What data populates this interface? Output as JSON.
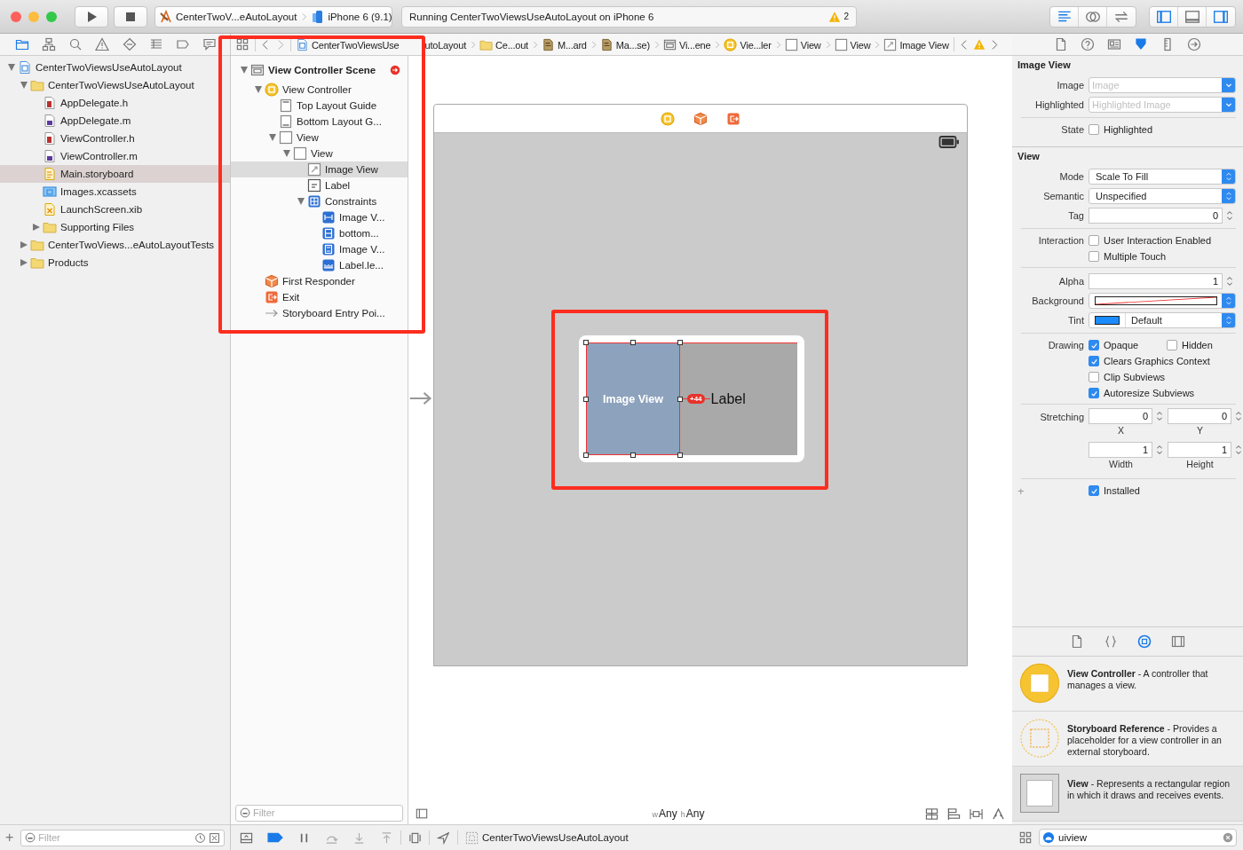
{
  "toolbar": {
    "scheme": "CenterTwoV...eAutoLayout",
    "device": "iPhone 6 (9.1)",
    "status": "Running CenterTwoViewsUseAutoLayout on iPhone 6",
    "warning_count": "2",
    "editor_modes": [
      {
        "kind": "standard",
        "selected": true
      },
      {
        "kind": "assistant",
        "selected": false
      },
      {
        "kind": "version",
        "selected": false
      }
    ],
    "panels": [
      {
        "kind": "navigator-panel",
        "on": true
      },
      {
        "kind": "debug-panel",
        "on": false
      },
      {
        "kind": "utilities-panel",
        "on": true
      }
    ]
  },
  "navigator_tabs": [
    {
      "kind": "project",
      "selected": true
    },
    {
      "kind": "symbol",
      "selected": false
    },
    {
      "kind": "find",
      "selected": false
    },
    {
      "kind": "issue",
      "selected": false
    },
    {
      "kind": "test",
      "selected": false
    },
    {
      "kind": "debug-nav",
      "selected": false
    },
    {
      "kind": "breakpoint",
      "selected": false
    },
    {
      "kind": "report",
      "selected": false
    }
  ],
  "file_tree": [
    {
      "name": "CenterTwoViewsUseAutoLayout",
      "kind": "project-file",
      "expanded": true,
      "selected": false,
      "children": [
        {
          "name": "CenterTwoViewsUseAutoLayout",
          "kind": "folder",
          "expanded": true,
          "selected": false,
          "children": [
            {
              "name": "AppDelegate.h",
              "kind": "h-file",
              "selected": false
            },
            {
              "name": "AppDelegate.m",
              "kind": "m-file",
              "selected": false
            },
            {
              "name": "ViewController.h",
              "kind": "h-file",
              "selected": false
            },
            {
              "name": "ViewController.m",
              "kind": "m-file",
              "selected": false
            },
            {
              "name": "Main.storyboard",
              "kind": "storyboard",
              "selected": true
            },
            {
              "name": "Images.xcassets",
              "kind": "assets",
              "selected": false
            },
            {
              "name": "LaunchScreen.xib",
              "kind": "xib",
              "selected": false
            },
            {
              "name": "Supporting Files",
              "kind": "folder",
              "expanded": false,
              "selected": false
            }
          ]
        },
        {
          "name": "CenterTwoViews...eAutoLayoutTests",
          "kind": "folder",
          "expanded": false,
          "selected": false
        },
        {
          "name": "Products",
          "kind": "folder",
          "expanded": false,
          "selected": false
        }
      ]
    }
  ],
  "navigator_filter": {
    "add": "+",
    "placeholder": "Filter"
  },
  "jump_bar": [
    {
      "kind": "project-file",
      "text": "CenterTwoViewsUse",
      "text_after": "utoLayout"
    },
    {
      "kind": "folder",
      "text": "Ce...out"
    },
    {
      "kind": "storyboard-dark",
      "text": "M...ard"
    },
    {
      "kind": "storyboard-dark",
      "text": "Ma...se)"
    },
    {
      "kind": "scene",
      "text": "Vi...ene"
    },
    {
      "kind": "vc",
      "text": "Vie...ler"
    },
    {
      "kind": "view",
      "text": "View"
    },
    {
      "kind": "view",
      "text": "View"
    },
    {
      "kind": "image",
      "text": "Image View"
    }
  ],
  "outline": {
    "filter_placeholder": "Filter",
    "scene": {
      "title": "View Controller Scene",
      "expanded": true,
      "children": [
        {
          "name": "View Controller",
          "kind": "vc",
          "expanded": true,
          "selected": false,
          "children": [
            {
              "name": "Top Layout Guide",
              "kind": "guide-top",
              "selected": false
            },
            {
              "name": "Bottom Layout G...",
              "kind": "guide-bottom",
              "selected": false
            },
            {
              "name": "View",
              "kind": "view",
              "expanded": true,
              "selected": false,
              "children": [
                {
                  "name": "View",
                  "kind": "view",
                  "expanded": true,
                  "selected": false,
                  "children": [
                    {
                      "name": "Image View",
                      "kind": "image",
                      "selected": true
                    },
                    {
                      "name": "Label",
                      "kind": "label",
                      "selected": false
                    },
                    {
                      "name": "Constraints",
                      "kind": "constraints",
                      "expanded": true,
                      "selected": false,
                      "children": [
                        {
                          "name": "Image V...",
                          "kind": "constraint-h",
                          "selected": false
                        },
                        {
                          "name": "bottom...",
                          "kind": "constraint-b",
                          "selected": false
                        },
                        {
                          "name": "Image V...",
                          "kind": "constraint-v",
                          "selected": false
                        },
                        {
                          "name": "Label.le...",
                          "kind": "constraint-w",
                          "selected": false
                        }
                      ]
                    }
                  ]
                }
              ]
            }
          ]
        },
        {
          "name": "First Responder",
          "kind": "responder",
          "selected": false
        },
        {
          "name": "Exit",
          "kind": "exit",
          "selected": false
        },
        {
          "name": "Storyboard Entry Poi...",
          "kind": "entry",
          "selected": false
        }
      ]
    }
  },
  "canvas": {
    "image_view": "Image View",
    "label": "Label",
    "constraint": "+44",
    "size_class": [
      {
        "prefix": "w",
        "value": "Any"
      },
      {
        "prefix": "h",
        "value": "Any"
      }
    ]
  },
  "debug_bar": {
    "breakpoints_active": true,
    "target": "CenterTwoViewsUseAutoLayout"
  },
  "inspector": {
    "tabs": [
      {
        "kind": "file",
        "selected": false
      },
      {
        "kind": "quick-help",
        "selected": false
      },
      {
        "kind": "identity",
        "selected": false
      },
      {
        "kind": "attributes",
        "selected": true
      },
      {
        "kind": "size",
        "selected": false
      },
      {
        "kind": "connections",
        "selected": false
      }
    ],
    "sections": [
      {
        "title": "Image View",
        "groups": [
          [
            {
              "kind": "combo",
              "label": "Image",
              "placeholder": "Image"
            },
            {
              "kind": "combo",
              "label": "Highlighted",
              "placeholder": "Highlighted Image"
            }
          ],
          [
            {
              "kind": "checks",
              "label": "State",
              "checks": [
                {
                  "text": "Highlighted",
                  "checked": false
                }
              ]
            }
          ]
        ]
      },
      {
        "title": "View",
        "groups": [
          [
            {
              "kind": "popup",
              "label": "Mode",
              "value": "Scale To Fill"
            },
            {
              "kind": "popup",
              "label": "Semantic",
              "value": "Unspecified"
            },
            {
              "kind": "stepper",
              "label": "Tag",
              "value": "0"
            }
          ],
          [
            {
              "kind": "checks",
              "label": "Interaction",
              "checks": [
                {
                  "text": "User Interaction Enabled",
                  "checked": false
                }
              ]
            },
            {
              "kind": "checks",
              "checks": [
                {
                  "text": "Multiple Touch",
                  "checked": false
                }
              ]
            }
          ],
          [
            {
              "kind": "stepper",
              "label": "Alpha",
              "value": "1"
            },
            {
              "kind": "color",
              "label": "Background",
              "clear": true
            },
            {
              "kind": "color",
              "label": "Tint",
              "clear": false,
              "value": "Default"
            }
          ],
          [
            {
              "kind": "checks",
              "label": "Drawing",
              "checks": [
                {
                  "text": "Opaque",
                  "checked": true
                },
                {
                  "text": "Hidden",
                  "checked": false
                }
              ]
            },
            {
              "kind": "checks",
              "checks": [
                {
                  "text": "Clears Graphics Context",
                  "checked": true
                }
              ]
            },
            {
              "kind": "checks",
              "checks": [
                {
                  "text": "Clip Subviews",
                  "checked": false
                }
              ]
            },
            {
              "kind": "checks",
              "checks": [
                {
                  "text": "Autoresize Subviews",
                  "checked": true
                }
              ]
            }
          ],
          [
            {
              "kind": "pair",
              "label": "Stretching",
              "fields": [
                {
                  "value": "0",
                  "caption": "X"
                },
                {
                  "value": "0",
                  "caption": "Y"
                }
              ]
            },
            {
              "kind": "pair",
              "fields": [
                {
                  "value": "1",
                  "caption": "Width"
                },
                {
                  "value": "1",
                  "caption": "Height"
                }
              ]
            }
          ],
          [
            {
              "kind": "checks",
              "prefix": "+",
              "checks": [
                {
                  "text": "Installed",
                  "checked": true
                }
              ]
            }
          ]
        ]
      }
    ]
  },
  "library": {
    "tabs": [
      {
        "kind": "file",
        "selected": false
      },
      {
        "kind": "code",
        "selected": false
      },
      {
        "kind": "object",
        "selected": true
      },
      {
        "kind": "media",
        "selected": false
      }
    ],
    "items": [
      {
        "kind": "view-controller",
        "text": "**View Controller** - A controller that manages a view.",
        "selected": false
      },
      {
        "kind": "storyboard-reference",
        "text": "**Storyboard Reference** - Provides a placeholder for a view controller in an external storyboard.",
        "selected": false
      },
      {
        "kind": "view",
        "text": "**View** - Represents a rectangular region in which it draws and receives events.",
        "selected": true
      }
    ],
    "search": "uiview"
  }
}
